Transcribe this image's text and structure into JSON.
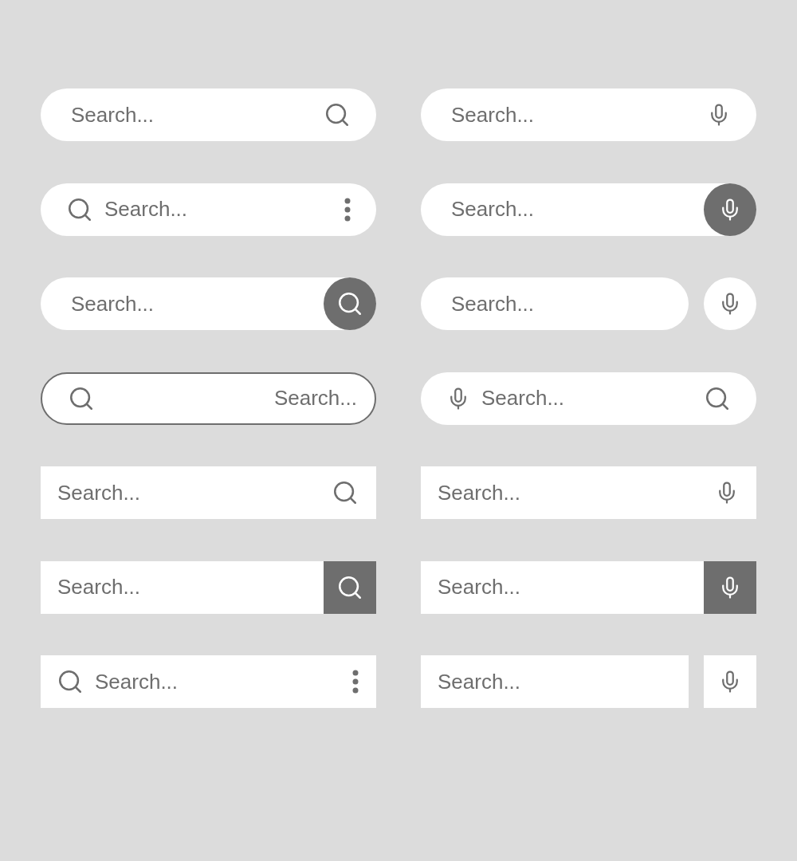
{
  "bars": [
    {
      "kind": "pill",
      "placeholder": "Search...",
      "trailing_icon": {
        "kind": "search"
      }
    },
    {
      "kind": "pill",
      "placeholder": "Search...",
      "trailing_icon": {
        "kind": "mic"
      }
    },
    {
      "kind": "pill",
      "placeholder": "Search...",
      "leading_icon": {
        "kind": "search"
      },
      "trailing_icon": {
        "kind": "menu"
      }
    },
    {
      "kind": "pillbutton",
      "placeholder": "Search...",
      "trailing_icon": {
        "kind": "mic"
      }
    },
    {
      "kind": "pillbutton",
      "placeholder": "Search...",
      "trailing_icon": {
        "kind": "search"
      }
    },
    {
      "kind": "pilldetached",
      "placeholder": "Search...",
      "trailing_icon": {
        "kind": "mic"
      }
    },
    {
      "kind": "pilloutlined",
      "placeholder": "Search...",
      "leading_icon": {
        "kind": "search"
      }
    },
    {
      "kind": "pill",
      "placeholder": "Search...",
      "leading_icon": {
        "kind": "mic"
      },
      "trailing_icon": {
        "kind": "search"
      }
    },
    {
      "kind": "rect",
      "placeholder": "Search...",
      "trailing_icon": {
        "kind": "search"
      }
    },
    {
      "kind": "rect",
      "placeholder": "Search...",
      "trailing_icon": {
        "kind": "mic"
      }
    },
    {
      "kind": "rectbutton",
      "placeholder": "Search...",
      "trailing_icon": {
        "kind": "search"
      }
    },
    {
      "kind": "rectbutton",
      "placeholder": "Search...",
      "trailing_icon": {
        "kind": "mic"
      }
    },
    {
      "kind": "rect",
      "placeholder": "Search...",
      "leading_icon": {
        "kind": "search"
      },
      "trailing_icon": {
        "kind": "menu"
      }
    },
    {
      "kind": "rectdetached",
      "placeholder": "Search...",
      "trailing_icon": {
        "kind": "mic"
      }
    }
  ]
}
